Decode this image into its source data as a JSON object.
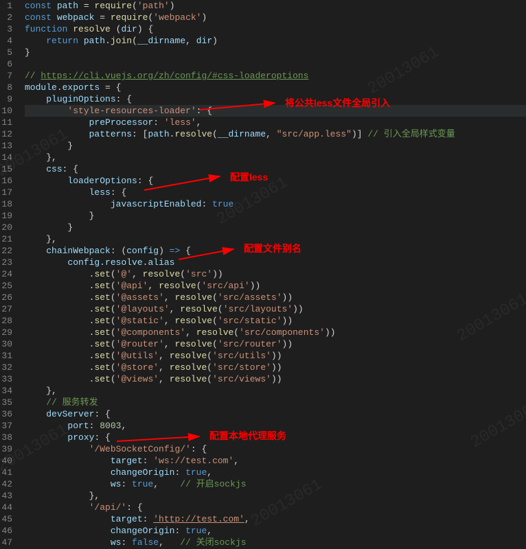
{
  "watermark": "20013061",
  "annotations": {
    "a1": "将公共less文件全局引入",
    "a2": "配置less",
    "a3": "配置文件别名",
    "a4": "配置本地代理服务"
  },
  "lines": {
    "l1": {
      "kw1": "const",
      "var1": "path",
      "op1": " = ",
      "fn1": "require",
      "pn1": "(",
      "str1": "'path'",
      "pn2": ")"
    },
    "l2": {
      "kw1": "const",
      "var1": "webpack",
      "op1": " = ",
      "fn1": "require",
      "pn1": "(",
      "str1": "'webpack'",
      "pn2": ")"
    },
    "l3": {
      "kw1": "function",
      "fn1": "resolve",
      "pn1": " (",
      "var1": "dir",
      "pn2": ") {"
    },
    "l4": {
      "kw1": "return",
      "var1": "path",
      "pn1": ".",
      "fn1": "join",
      "pn2": "(",
      "var2": "__dirname",
      "pn3": ", ",
      "var3": "dir",
      "pn4": ")"
    },
    "l5": {
      "pn1": "}"
    },
    "l7": {
      "cmt1": "// ",
      "link1": "https://cli.vuejs.org/zh/config/#css-loaderoptions"
    },
    "l8": {
      "var1": "module",
      "pn1": ".",
      "var2": "exports",
      "op1": " = {"
    },
    "l9": {
      "prop1": "pluginOptions",
      "pn1": ": {"
    },
    "l10": {
      "str1": "'style-resources-loader'",
      "pn1": ": {"
    },
    "l11": {
      "prop1": "preProcessor",
      "pn1": ": ",
      "str1": "'less'",
      "pn2": ","
    },
    "l12": {
      "prop1": "patterns",
      "pn1": ": [",
      "var1": "path",
      "pn2": ".",
      "fn1": "resolve",
      "pn3": "(",
      "var2": "__dirname",
      "pn4": ", ",
      "str1": "\"src/app.less\"",
      "pn5": ")] ",
      "cmt1": "// 引入全局样式变量"
    },
    "l13": {
      "pn1": "}"
    },
    "l14": {
      "pn1": "},"
    },
    "l15": {
      "prop1": "css",
      "pn1": ": {"
    },
    "l16": {
      "prop1": "loaderOptions",
      "pn1": ": {"
    },
    "l17": {
      "prop1": "less",
      "pn1": ": {"
    },
    "l18": {
      "prop1": "javascriptEnabled",
      "pn1": ": ",
      "bool1": "true"
    },
    "l19": {
      "pn1": "}"
    },
    "l20": {
      "pn1": "}"
    },
    "l21": {
      "pn1": "},"
    },
    "l22": {
      "prop1": "chainWebpack",
      "pn1": ": (",
      "var1": "config",
      "pn2": ") ",
      "kw1": "=>",
      "pn3": " {"
    },
    "l23": {
      "var1": "config",
      "pn1": ".",
      "var2": "resolve",
      "pn2": ".",
      "var3": "alias"
    },
    "l24": {
      "pn1": ".",
      "fn1": "set",
      "pn2": "(",
      "str1": "'@'",
      "pn3": ", ",
      "fn2": "resolve",
      "pn4": "(",
      "str2": "'src'",
      "pn5": "))"
    },
    "l25": {
      "pn1": ".",
      "fn1": "set",
      "pn2": "(",
      "str1": "'@api'",
      "pn3": ", ",
      "fn2": "resolve",
      "pn4": "(",
      "str2": "'src/api'",
      "pn5": "))"
    },
    "l26": {
      "pn1": ".",
      "fn1": "set",
      "pn2": "(",
      "str1": "'@assets'",
      "pn3": ", ",
      "fn2": "resolve",
      "pn4": "(",
      "str2": "'src/assets'",
      "pn5": "))"
    },
    "l27": {
      "pn1": ".",
      "fn1": "set",
      "pn2": "(",
      "str1": "'@layouts'",
      "pn3": ", ",
      "fn2": "resolve",
      "pn4": "(",
      "str2": "'src/layouts'",
      "pn5": "))"
    },
    "l28": {
      "pn1": ".",
      "fn1": "set",
      "pn2": "(",
      "str1": "'@static'",
      "pn3": ", ",
      "fn2": "resolve",
      "pn4": "(",
      "str2": "'src/static'",
      "pn5": "))"
    },
    "l29": {
      "pn1": ".",
      "fn1": "set",
      "pn2": "(",
      "str1": "'@components'",
      "pn3": ", ",
      "fn2": "resolve",
      "pn4": "(",
      "str2": "'src/components'",
      "pn5": "))"
    },
    "l30": {
      "pn1": ".",
      "fn1": "set",
      "pn2": "(",
      "str1": "'@router'",
      "pn3": ", ",
      "fn2": "resolve",
      "pn4": "(",
      "str2": "'src/router'",
      "pn5": "))"
    },
    "l31": {
      "pn1": ".",
      "fn1": "set",
      "pn2": "(",
      "str1": "'@utils'",
      "pn3": ", ",
      "fn2": "resolve",
      "pn4": "(",
      "str2": "'src/utils'",
      "pn5": "))"
    },
    "l32": {
      "pn1": ".",
      "fn1": "set",
      "pn2": "(",
      "str1": "'@store'",
      "pn3": ", ",
      "fn2": "resolve",
      "pn4": "(",
      "str2": "'src/store'",
      "pn5": "))"
    },
    "l33": {
      "pn1": ".",
      "fn1": "set",
      "pn2": "(",
      "str1": "'@views'",
      "pn3": ", ",
      "fn2": "resolve",
      "pn4": "(",
      "str2": "'src/views'",
      "pn5": "))"
    },
    "l34": {
      "pn1": "},"
    },
    "l35": {
      "cmt1": "// 服务转发"
    },
    "l36": {
      "prop1": "devServer",
      "pn1": ": {"
    },
    "l37": {
      "prop1": "port",
      "pn1": ": ",
      "num1": "8003",
      "pn2": ","
    },
    "l38": {
      "prop1": "proxy",
      "pn1": ": {"
    },
    "l39": {
      "str1": "'/WebSocketConfig/'",
      "pn1": ": {"
    },
    "l40": {
      "prop1": "target",
      "pn1": ": ",
      "str1": "'ws://test.com'",
      "pn2": ","
    },
    "l41": {
      "prop1": "changeOrigin",
      "pn1": ": ",
      "bool1": "true",
      "pn2": ","
    },
    "l42": {
      "prop1": "ws",
      "pn1": ": ",
      "bool1": "true",
      "pn2": ",    ",
      "cmt1": "// 开启sockjs"
    },
    "l43": {
      "pn1": "},"
    },
    "l44": {
      "str1": "'/api/'",
      "pn1": ": {"
    },
    "l45": {
      "prop1": "target",
      "pn1": ": ",
      "str1": "'http://test.com'",
      "pn2": ","
    },
    "l46": {
      "prop1": "changeOrigin",
      "pn1": ": ",
      "bool1": "true",
      "pn2": ","
    },
    "l47": {
      "prop1": "ws",
      "pn1": ": ",
      "bool1": "false",
      "pn2": ",   ",
      "cmt1": "// 关闭sockjs"
    }
  },
  "lineNumbers": [
    "1",
    "2",
    "3",
    "4",
    "5",
    "6",
    "7",
    "8",
    "9",
    "10",
    "11",
    "12",
    "13",
    "14",
    "15",
    "16",
    "17",
    "18",
    "19",
    "20",
    "21",
    "22",
    "23",
    "24",
    "25",
    "26",
    "27",
    "28",
    "29",
    "30",
    "31",
    "32",
    "33",
    "34",
    "35",
    "36",
    "37",
    "38",
    "39",
    "40",
    "41",
    "42",
    "43",
    "44",
    "45",
    "46",
    "47"
  ]
}
